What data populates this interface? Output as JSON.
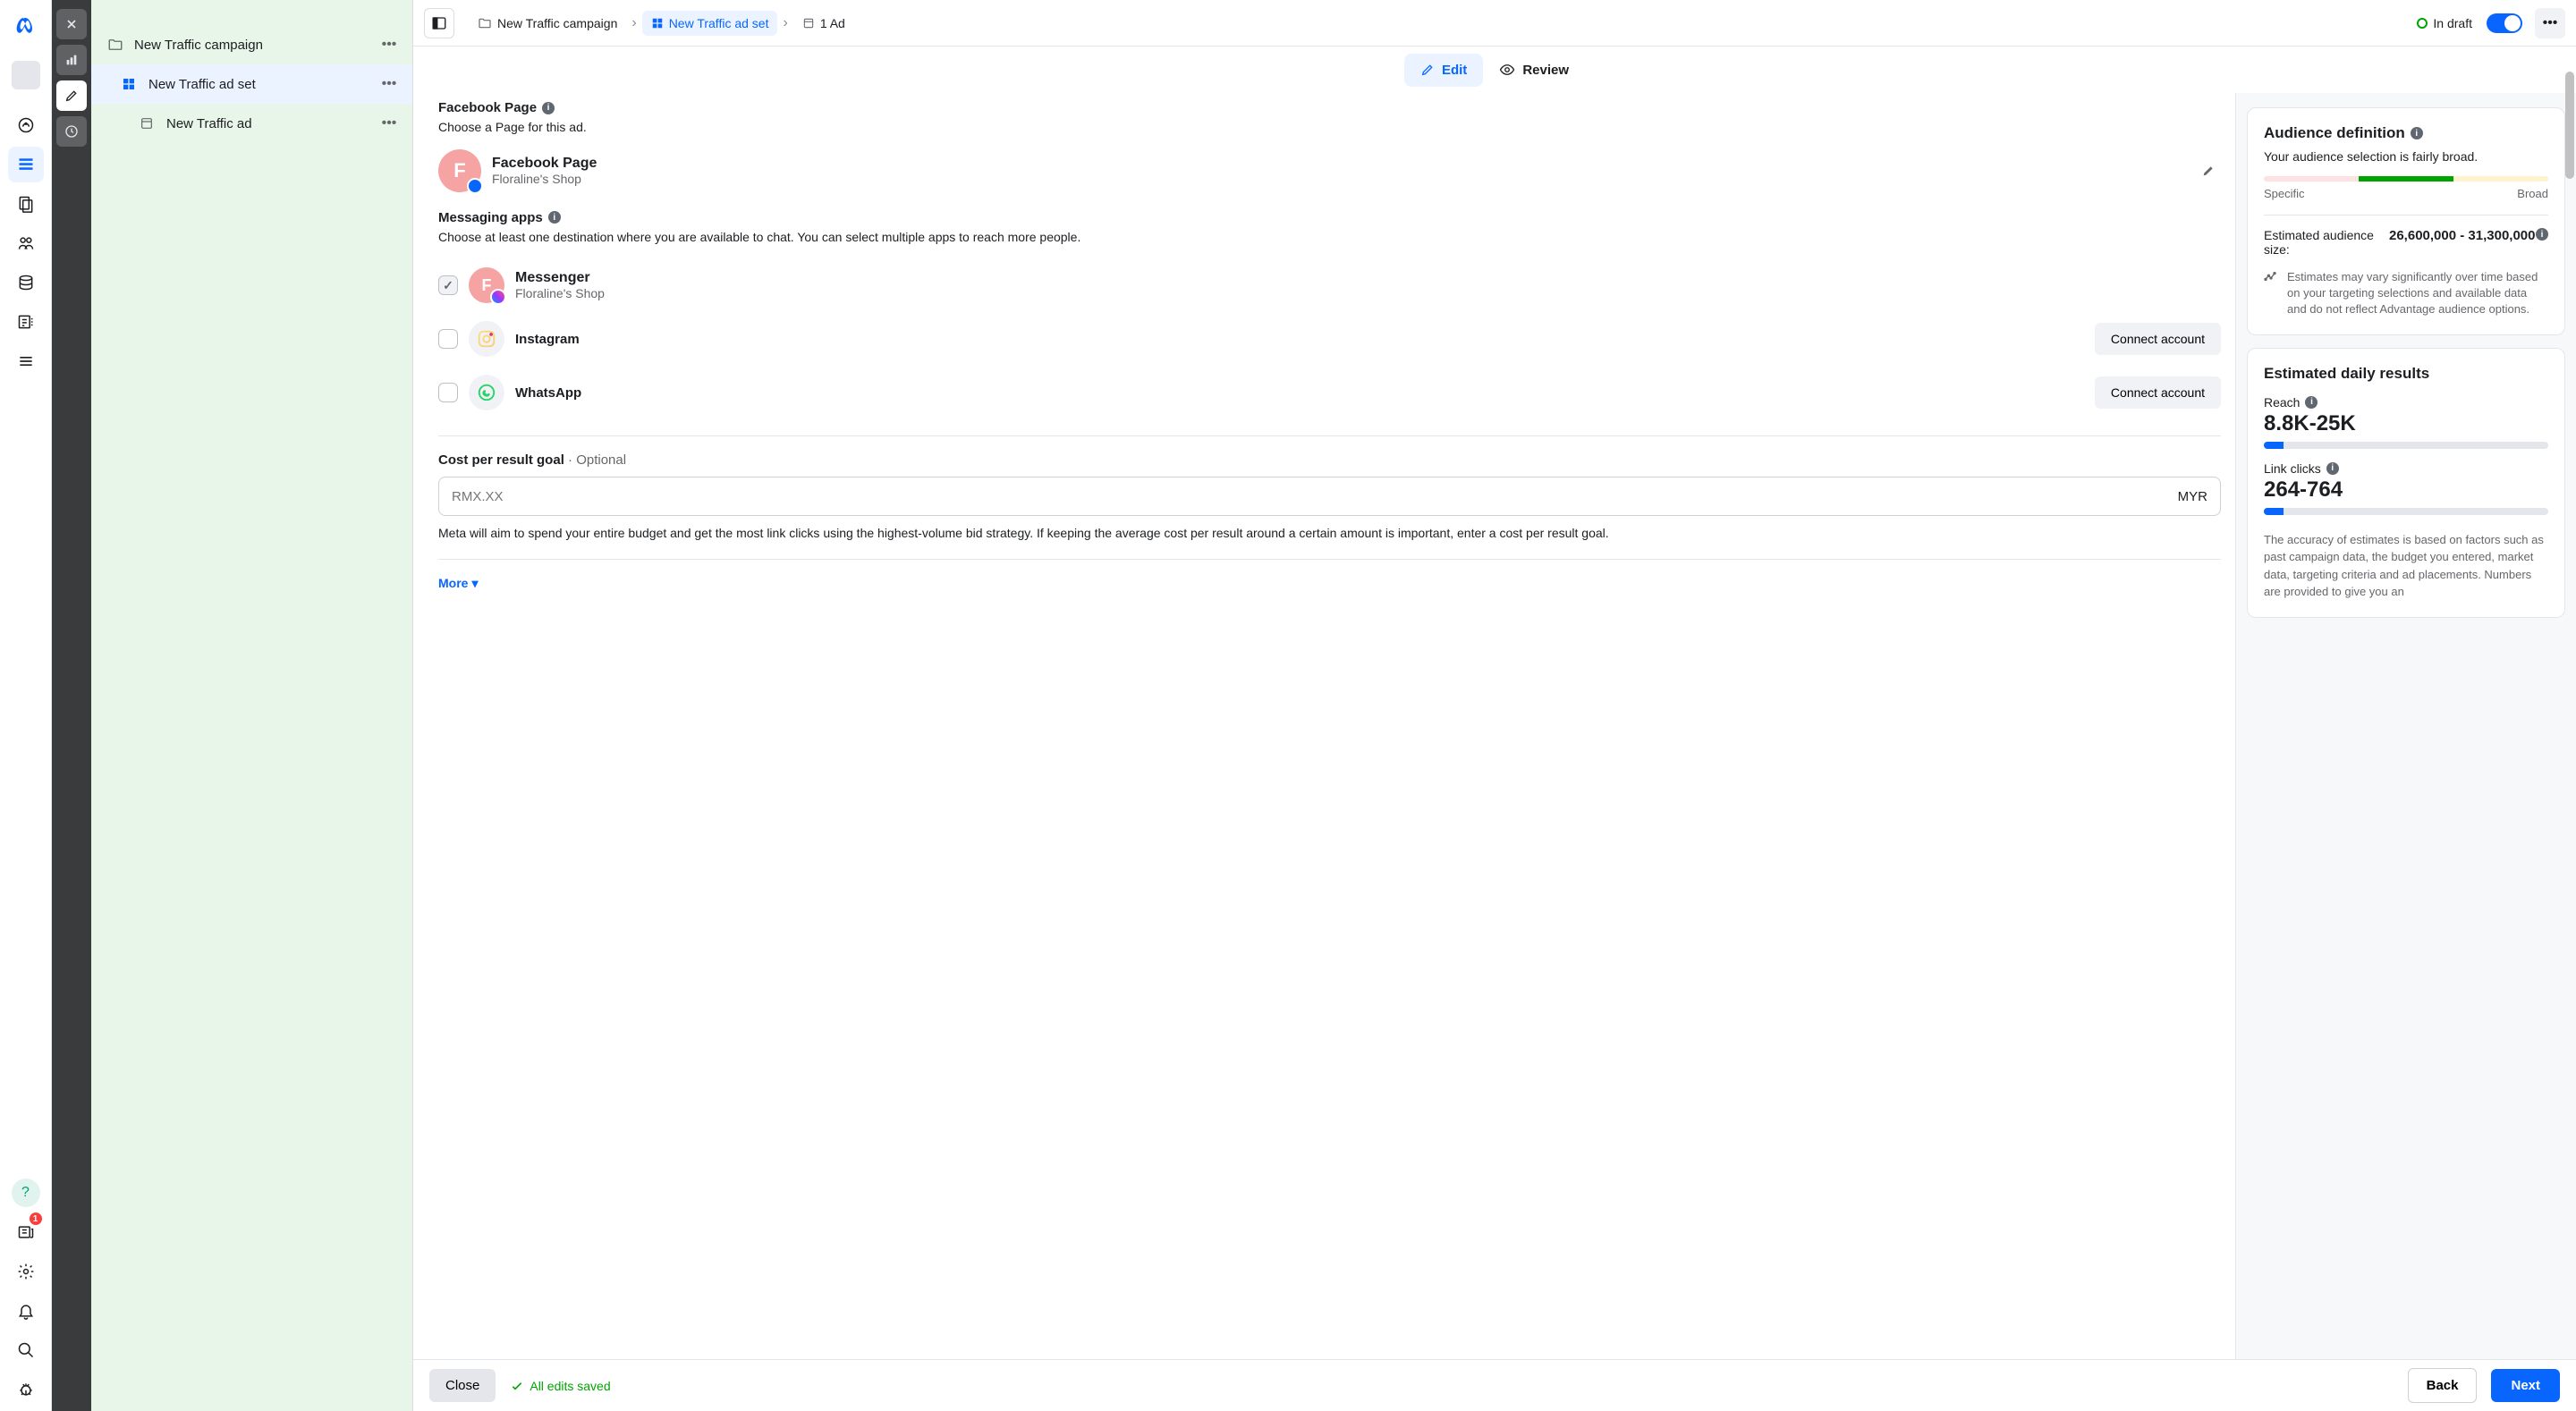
{
  "rail1": {
    "notification_badge": "1"
  },
  "tree": {
    "items": [
      {
        "label": "New Traffic campaign"
      },
      {
        "label": "New Traffic ad set"
      },
      {
        "label": "New Traffic ad"
      }
    ]
  },
  "breadcrumbs": {
    "items": [
      {
        "label": "New Traffic campaign"
      },
      {
        "label": "New Traffic ad set"
      },
      {
        "label": "1 Ad"
      }
    ],
    "status": "In draft"
  },
  "tabs": {
    "edit": "Edit",
    "review": "Review"
  },
  "form": {
    "facebook_page": {
      "title": "Facebook Page",
      "help": "Choose a Page for this ad.",
      "page_name": "Facebook Page",
      "page_sub": "Floraline's Shop",
      "avatar_letter": "F"
    },
    "messaging": {
      "title": "Messaging apps",
      "help": "Choose at least one destination where you are available to chat. You can select multiple apps to reach more people.",
      "apps": {
        "messenger": {
          "name": "Messenger",
          "sub": "Floraline's Shop",
          "avatar_letter": "F"
        },
        "instagram": {
          "name": "Instagram",
          "connect": "Connect account"
        },
        "whatsapp": {
          "name": "WhatsApp",
          "connect": "Connect account"
        }
      }
    },
    "cost": {
      "label": "Cost per result goal",
      "optional": " · Optional",
      "placeholder": "RMX.XX",
      "currency": "MYR",
      "help": "Meta will aim to spend your entire budget and get the most link clicks using the highest-volume bid strategy. If keeping the average cost per result around a certain amount is important, enter a cost per result goal."
    },
    "more": "More"
  },
  "side": {
    "audience": {
      "title": "Audience definition",
      "desc": "Your audience selection is fairly broad.",
      "specific": "Specific",
      "broad": "Broad",
      "est_label": "Estimated audience size:",
      "est_value": "26,600,000 - 31,300,000",
      "disclaim": "Estimates may vary significantly over time based on your targeting selections and available data and do not reflect Advantage audience options."
    },
    "daily": {
      "title": "Estimated daily results",
      "reach_lbl": "Reach",
      "reach_val": "8.8K-25K",
      "clicks_lbl": "Link clicks",
      "clicks_val": "264-764",
      "accuracy": "The accuracy of estimates is based on factors such as past campaign data, the budget you entered, market data, targeting criteria and ad placements. Numbers are provided to give you an"
    }
  },
  "footer": {
    "close": "Close",
    "saved": "All edits saved",
    "back": "Back",
    "next": "Next"
  }
}
